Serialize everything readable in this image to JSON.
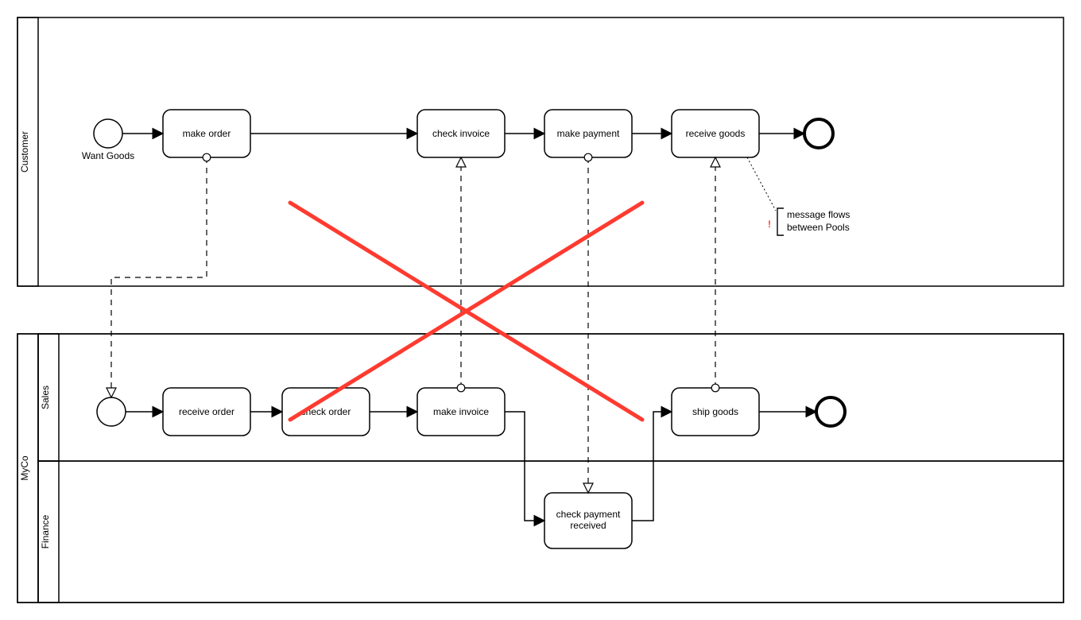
{
  "pools": {
    "customer": {
      "label": "Customer"
    },
    "myco": {
      "label": "MyCo",
      "lanes": {
        "sales": {
          "label": "Sales"
        },
        "finance": {
          "label": "Finance"
        }
      }
    }
  },
  "events": {
    "wantGoods": {
      "label": "Want Goods"
    }
  },
  "tasks": {
    "makeOrder": {
      "label": "make order"
    },
    "checkInvoice": {
      "label": "check invoice"
    },
    "makePayment": {
      "label": "make payment"
    },
    "receiveGoods": {
      "label": "receive goods"
    },
    "receiveOrder": {
      "label": "receive order"
    },
    "checkOrder": {
      "label": "check order"
    },
    "makeInvoice": {
      "label": "make invoice"
    },
    "shipGoods": {
      "label": "ship goods"
    },
    "checkPaymentReceived": {
      "label": "check payment received"
    }
  },
  "annotation": {
    "marker": "!",
    "text": "message flows\nbetween Pools"
  },
  "colors": {
    "error": "#ff3b30",
    "stroke": "#000000"
  }
}
